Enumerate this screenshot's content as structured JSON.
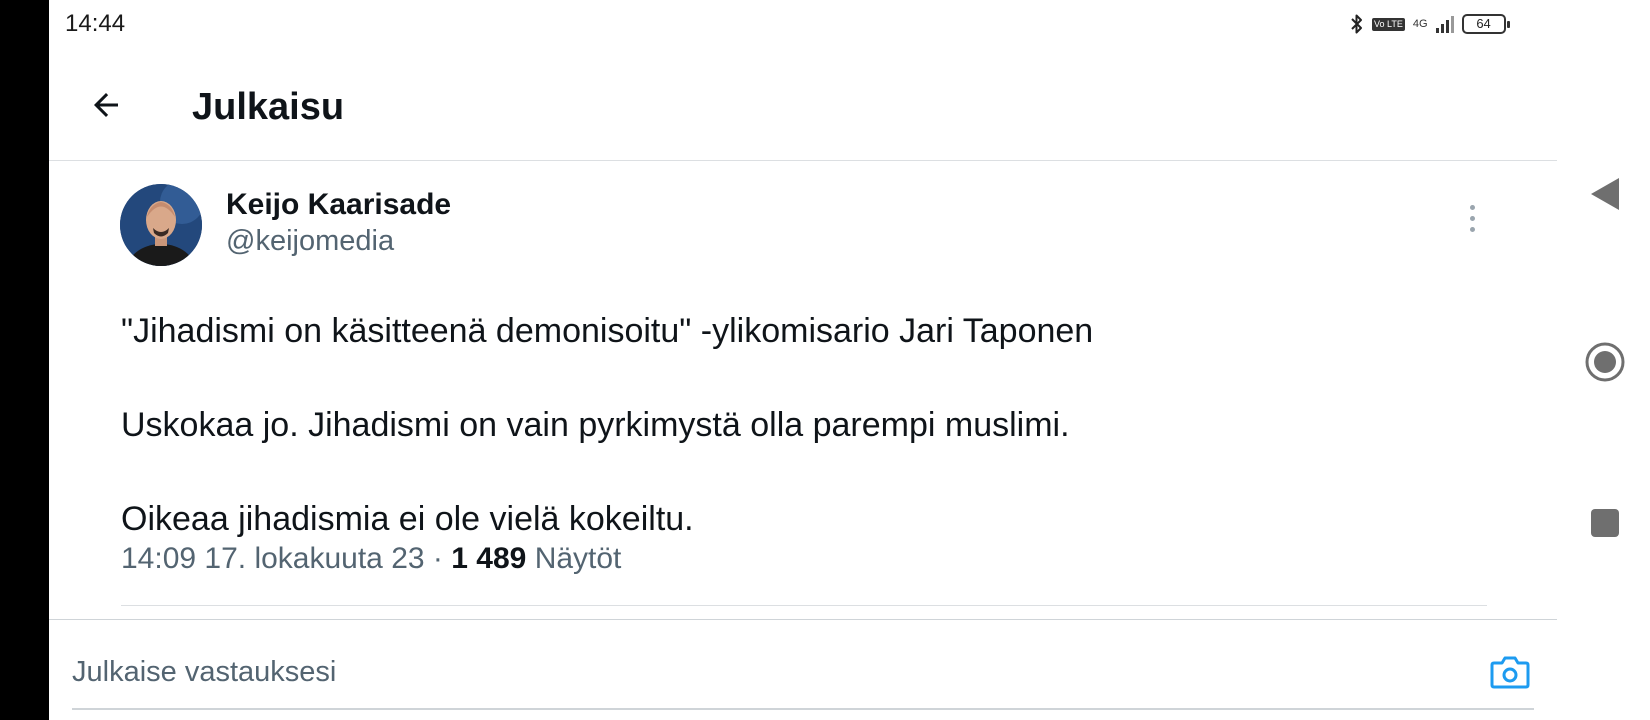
{
  "status_bar": {
    "time": "14:44",
    "battery": "64",
    "network": "4G",
    "volte": "Vo LTE",
    "icons": [
      "bluetooth-icon",
      "volte-icon",
      "signal-icon",
      "battery-icon"
    ]
  },
  "header": {
    "title": "Julkaisu",
    "back_icon": "arrow-left-icon"
  },
  "post": {
    "author_name": "Keijo Kaarisade",
    "author_handle": "@keijomedia",
    "lines": [
      "\"Jihadismi on käsitteenä demonisoitu\" -ylikomisario Jari Taponen",
      "Uskokaa jo. Jihadismi on vain pyrkimystä olla parempi muslimi.",
      "Oikeaa jihadismia ei ole vielä kokeiltu."
    ],
    "timestamp": "14:09 17. lokakuuta 23",
    "separator": "·",
    "views_count": "1 489",
    "views_label": "Näytöt",
    "more_icon": "more-vertical-icon"
  },
  "reply": {
    "placeholder": "Julkaise vastauksesi",
    "camera_icon": "camera-icon"
  },
  "system_nav": {
    "icons": [
      "nav-back-icon",
      "nav-home-icon",
      "nav-recents-icon"
    ]
  },
  "colors": {
    "text_primary": "#0f1419",
    "text_secondary": "#536471",
    "accent": "#1d9bf0",
    "divider": "#dcdfe2",
    "nav_icon": "#6f6f6f"
  }
}
